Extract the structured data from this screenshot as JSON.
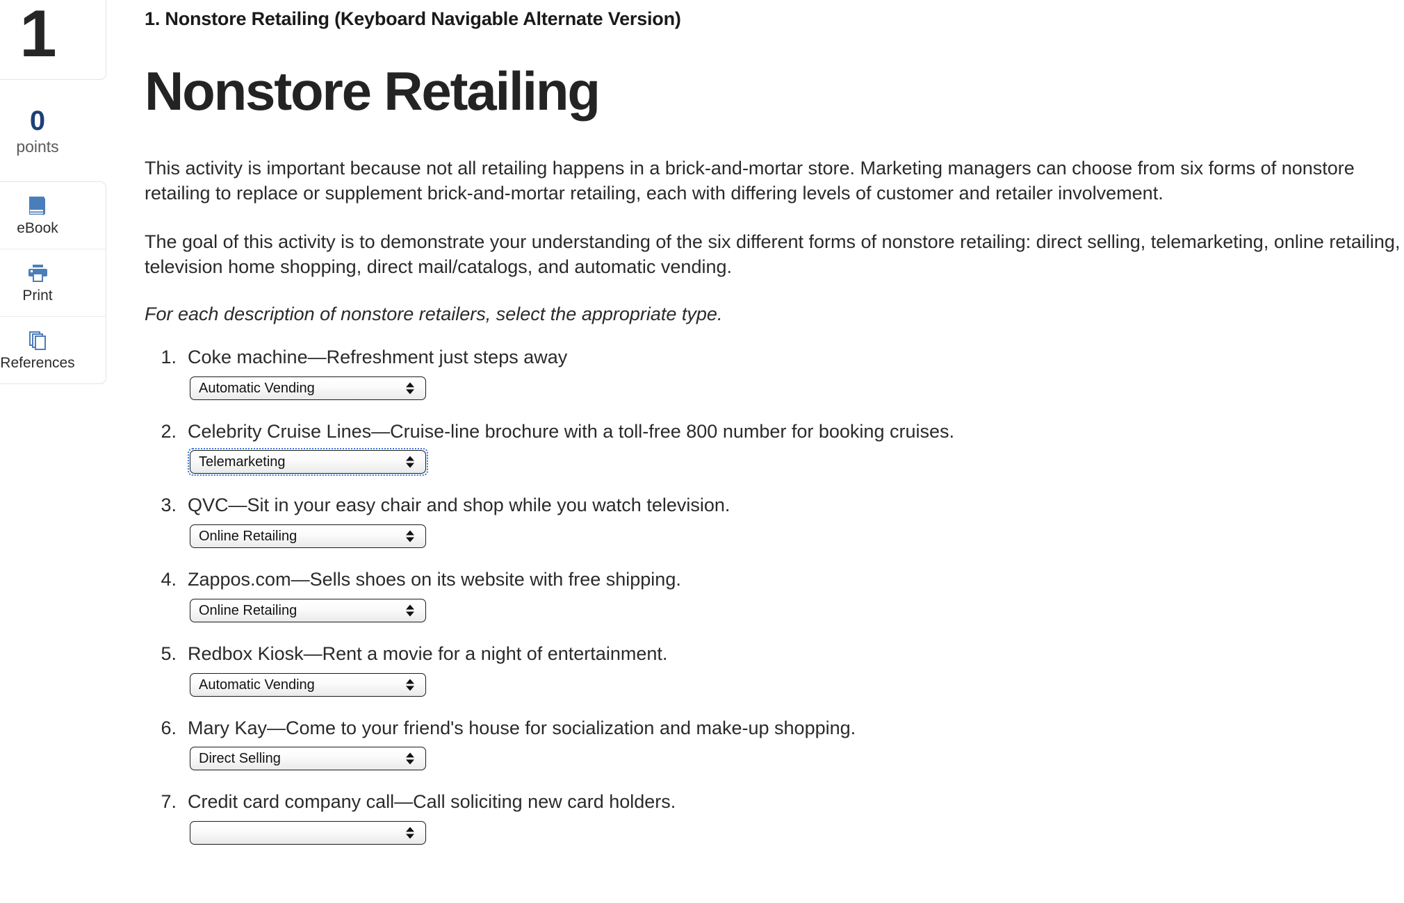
{
  "sidebar": {
    "question_number": "1",
    "points_value": "0",
    "points_label": "points",
    "tools": [
      {
        "label": "eBook",
        "icon": "book-icon"
      },
      {
        "label": "Print",
        "icon": "printer-icon"
      },
      {
        "label": "References",
        "icon": "pages-stack-icon"
      }
    ],
    "accent_color": "#4a7ebb",
    "points_color": "#1f3f77"
  },
  "main": {
    "activity_title": "1. Nonstore Retailing (Keyboard Navigable Alternate Version)",
    "heading": "Nonstore Retailing",
    "paragraph_1": "This activity is important because not all retailing happens in a brick-and-mortar store. Marketing managers can choose from six forms of nonstore retailing to replace or supplement brick-and-mortar retailing, each with differing levels of customer and retailer involvement.",
    "paragraph_2": "The goal of this activity is to demonstrate your understanding of the six different forms of nonstore retailing: direct selling, telemarketing, online retailing, television home shopping, direct mail/catalogs, and automatic vending.",
    "instruction": "For each description of nonstore retailers, select the appropriate type."
  },
  "questions": [
    {
      "marker": "1.",
      "text": "Coke machine—Refreshment just steps away",
      "selected": "Automatic Vending",
      "focused": false
    },
    {
      "marker": "2.",
      "text": "Celebrity Cruise Lines—Cruise-line brochure with a toll-free 800 number for booking cruises.",
      "selected": "Telemarketing",
      "focused": true
    },
    {
      "marker": "3.",
      "text": "QVC—Sit in your easy chair and shop while you watch television.",
      "selected": "Online Retailing",
      "focused": false
    },
    {
      "marker": "4.",
      "text": "Zappos.com—Sells shoes on its website with free shipping.",
      "selected": "Online Retailing",
      "focused": false
    },
    {
      "marker": "5.",
      "text": "Redbox Kiosk—Rent a movie for a night of entertainment.",
      "selected": "Automatic Vending",
      "focused": false
    },
    {
      "marker": "6.",
      "text": "Mary Kay—Come to your friend's house for socialization and make-up shopping.",
      "selected": "Direct Selling",
      "focused": false
    },
    {
      "marker": "7.",
      "text": "Credit card company call—Call soliciting new card holders.",
      "selected": "",
      "focused": false
    }
  ]
}
